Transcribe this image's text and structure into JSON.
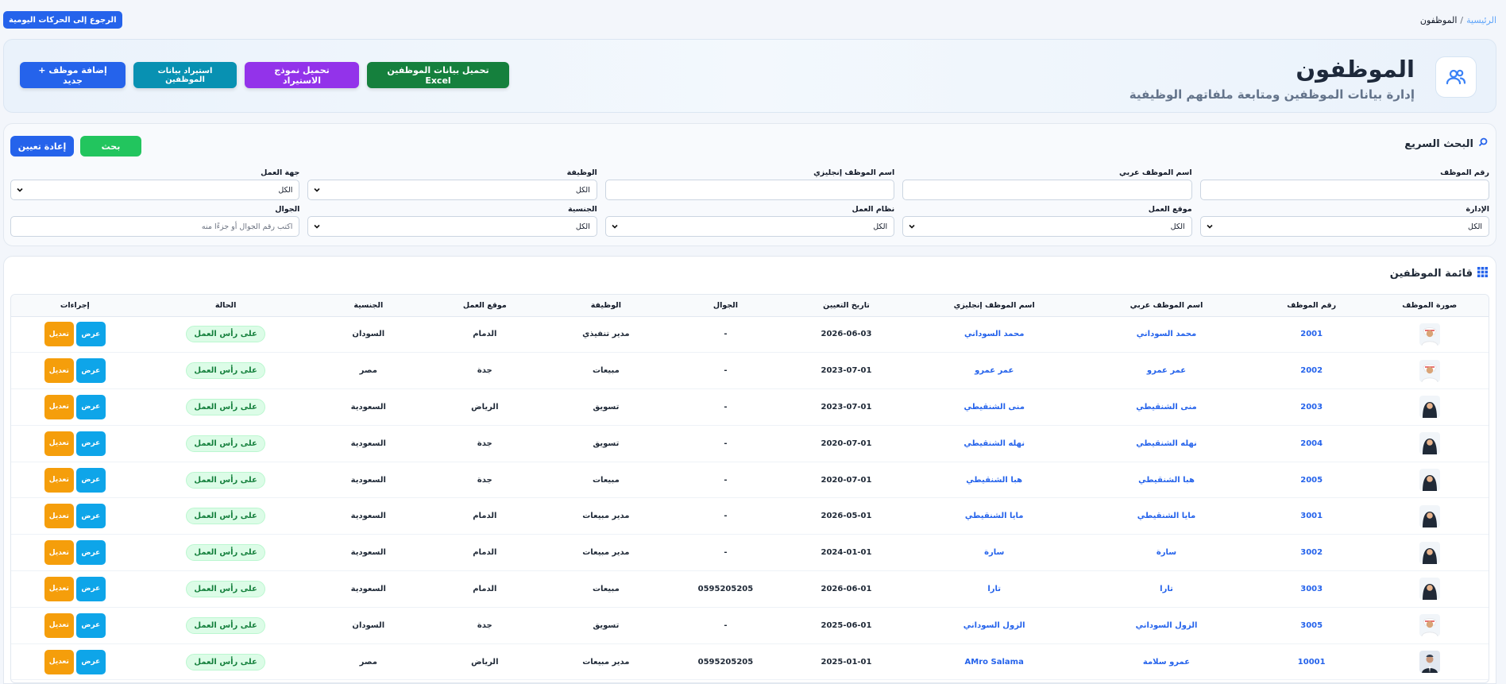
{
  "breadcrumb": {
    "home": "الرئيسية",
    "separator": "/",
    "current": "الموظفون"
  },
  "back_button": "الرجوع إلى الحركات اليومية",
  "header": {
    "title": "الموظفون",
    "subtitle": "إدارة بيانات الموظفين ومتابعة ملفاتهم الوظيفية",
    "icon": "users-icon",
    "buttons": {
      "add": "+ إضافة موظف جديد",
      "import": "استيراد بيانات الموظفين",
      "template": "تحميل نموذج الاستيراد",
      "excel": "تحميل بيانات الموظفين Excel"
    }
  },
  "search": {
    "title": "البحث السريع",
    "search_button": "بحث",
    "reset_button": "إعادة تعيين",
    "filters": {
      "emp_no": {
        "label": "رقم الموظف",
        "value": ""
      },
      "name_ar": {
        "label": "اسم الموظف عربي",
        "value": ""
      },
      "name_en": {
        "label": "اسم الموظف إنجليزي",
        "value": ""
      },
      "job": {
        "label": "الوظيفة",
        "value": "الكل"
      },
      "work_entity": {
        "label": "جهة العمل",
        "value": "الكل"
      },
      "department": {
        "label": "الإدارة",
        "value": "الكل"
      },
      "work_location": {
        "label": "موقع العمل",
        "value": "الكل"
      },
      "work_system": {
        "label": "نظام العمل",
        "value": "الكل"
      },
      "nationality": {
        "label": "الجنسية",
        "value": "الكل"
      },
      "mobile": {
        "label": "الجوال",
        "placeholder": "اكتب رقم الجوال أو جزءًا منه"
      }
    }
  },
  "list": {
    "title": "قائمة الموظفين",
    "columns": {
      "photo": "صورة الموظف",
      "emp_no": "رقم الموظف",
      "name_ar": "اسم الموظف عربي",
      "name_en": "اسم الموظف إنجليزي",
      "hire_date": "تاريخ التعيين",
      "mobile": "الجوال",
      "job": "الوظيفة",
      "location": "موقع العمل",
      "nationality": "الجنسية",
      "status": "الحالة",
      "actions": "إجراءات"
    },
    "view_label": "عرض",
    "edit_label": "تعديل",
    "rows": [
      {
        "avatar": "male",
        "emp_no": "2001",
        "name_ar": "محمد السوداني",
        "name_en": "محمد السوداني",
        "hire_date": "2026-06-03",
        "mobile": "-",
        "job": "مدير تنفيذي",
        "location": "الدمام",
        "nationality": "السودان",
        "status": "على رأس العمل"
      },
      {
        "avatar": "male",
        "emp_no": "2002",
        "name_ar": "عمر عمرو",
        "name_en": "عمر عمرو",
        "hire_date": "2023-07-01",
        "mobile": "-",
        "job": "مبيعات",
        "location": "جدة",
        "nationality": "مصر",
        "status": "على رأس العمل"
      },
      {
        "avatar": "female",
        "emp_no": "2003",
        "name_ar": "منى الشنقيطي",
        "name_en": "منى الشنقيطي",
        "hire_date": "2023-07-01",
        "mobile": "-",
        "job": "تسويق",
        "location": "الرياض",
        "nationality": "السعودية",
        "status": "على رأس العمل"
      },
      {
        "avatar": "female",
        "emp_no": "2004",
        "name_ar": "نهله الشنقيطي",
        "name_en": "نهله الشنقيطي",
        "hire_date": "2020-07-01",
        "mobile": "-",
        "job": "تسويق",
        "location": "جدة",
        "nationality": "السعودية",
        "status": "على رأس العمل"
      },
      {
        "avatar": "female",
        "emp_no": "2005",
        "name_ar": "هبا الشنقيطي",
        "name_en": "هبا الشنقيطي",
        "hire_date": "2020-07-01",
        "mobile": "-",
        "job": "مبيعات",
        "location": "جدة",
        "nationality": "السعودية",
        "status": "على رأس العمل"
      },
      {
        "avatar": "female",
        "emp_no": "3001",
        "name_ar": "مايا الشنقيطي",
        "name_en": "مايا الشنقيطي",
        "hire_date": "2026-05-01",
        "mobile": "-",
        "job": "مدير مبيعات",
        "location": "الدمام",
        "nationality": "السعودية",
        "status": "على رأس العمل"
      },
      {
        "avatar": "female",
        "emp_no": "3002",
        "name_ar": "سارة",
        "name_en": "سارة",
        "hire_date": "2024-01-01",
        "mobile": "-",
        "job": "مدير مبيعات",
        "location": "الدمام",
        "nationality": "السعودية",
        "status": "على رأس العمل"
      },
      {
        "avatar": "female",
        "emp_no": "3003",
        "name_ar": "تارا",
        "name_en": "تارا",
        "hire_date": "2026-06-01",
        "mobile": "0595205205",
        "job": "مبيعات",
        "location": "الدمام",
        "nationality": "السعودية",
        "status": "على رأس العمل"
      },
      {
        "avatar": "male",
        "emp_no": "3005",
        "name_ar": "الزول السوداني",
        "name_en": "الزول السوداني",
        "hire_date": "2025-06-01",
        "mobile": "-",
        "job": "تسويق",
        "location": "جدة",
        "nationality": "السودان",
        "status": "على رأس العمل"
      },
      {
        "avatar": "suit",
        "emp_no": "10001",
        "name_ar": "عمرو سلامة",
        "name_en": "AMro Salama",
        "hire_date": "2025-01-01",
        "mobile": "0595205205",
        "job": "مدير مبيعات",
        "location": "الرياض",
        "nationality": "مصر",
        "status": "على رأس العمل"
      }
    ]
  },
  "colors": {
    "primary": "#2563eb",
    "success": "#22c55e",
    "teal": "#0891b2",
    "purple": "#9333ea",
    "excel_green": "#15803d",
    "view": "#0ea5e9",
    "edit": "#f59e0b"
  }
}
